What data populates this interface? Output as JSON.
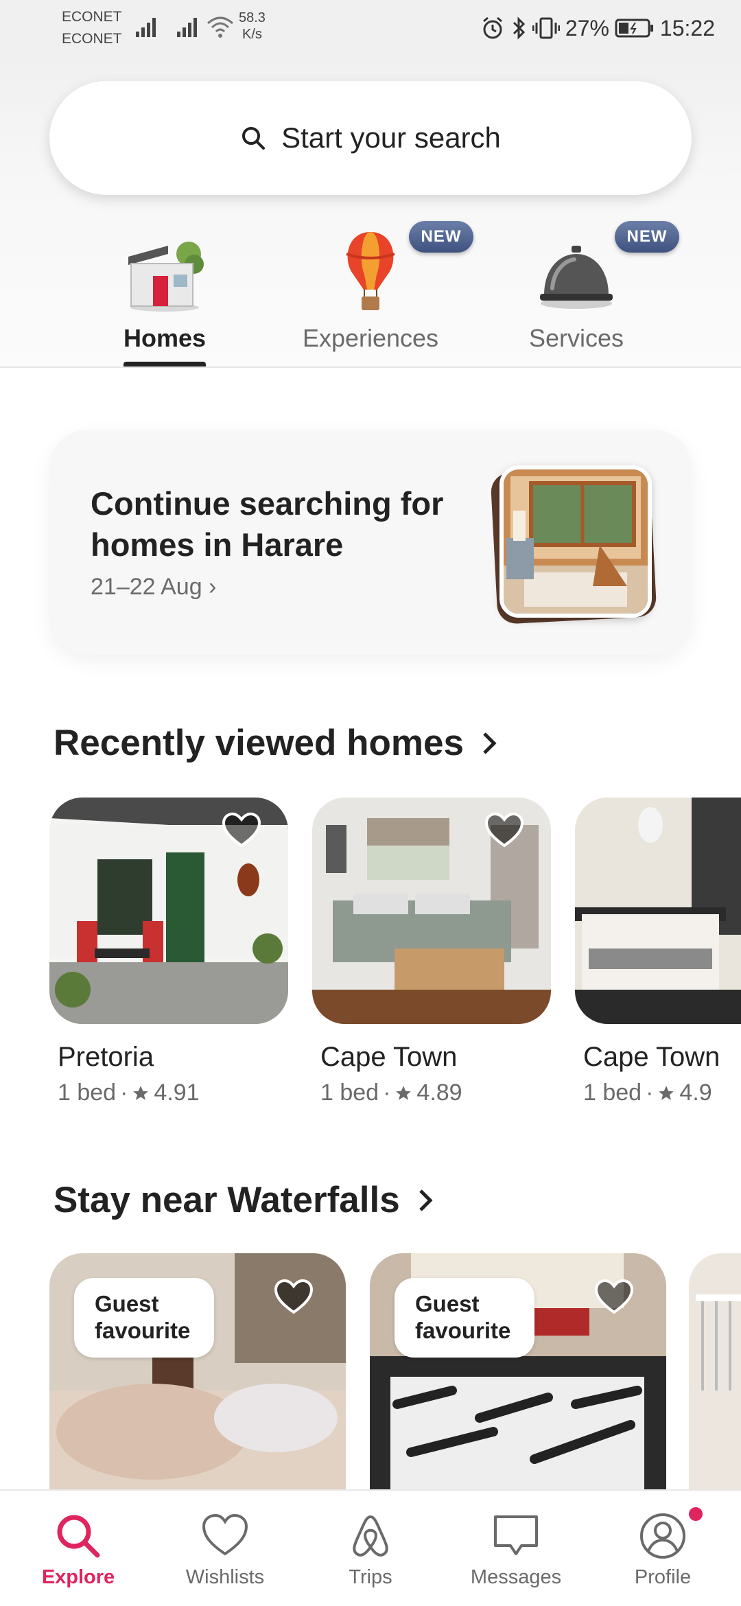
{
  "status_bar": {
    "carrier_1": "ECONET",
    "carrier_2": "ECONET",
    "net_speed_value": "58.3",
    "net_speed_unit": "K/s",
    "battery": "27%",
    "time": "15:22"
  },
  "search": {
    "label": "Start your search",
    "icon": "search-icon"
  },
  "categories": [
    {
      "label": "Homes",
      "active": true,
      "badge": ""
    },
    {
      "label": "Experiences",
      "active": false,
      "badge": "NEW"
    },
    {
      "label": "Services",
      "active": false,
      "badge": "NEW"
    }
  ],
  "continue_card": {
    "title": "Continue searching for homes in Harare",
    "dates": "21–22 Aug",
    "chevron": "›"
  },
  "recently_viewed": {
    "heading": "Recently viewed homes",
    "items": [
      {
        "city": "Pretoria",
        "beds": "1 bed",
        "rating": "4.91"
      },
      {
        "city": "Cape Town",
        "beds": "1 bed",
        "rating": "4.89"
      },
      {
        "city": "Cape Town",
        "beds": "1 bed",
        "rating": "4.9"
      }
    ]
  },
  "waterfalls": {
    "heading": "Stay near Waterfalls",
    "items": [
      {
        "badge_line1": "Guest",
        "badge_line2": "favourite"
      },
      {
        "badge_line1": "Guest",
        "badge_line2": "favourite"
      }
    ]
  },
  "bottom_nav": [
    {
      "label": "Explore",
      "icon": "search-icon",
      "active": true
    },
    {
      "label": "Wishlists",
      "icon": "heart-icon",
      "active": false
    },
    {
      "label": "Trips",
      "icon": "airbnb-logo-icon",
      "active": false
    },
    {
      "label": "Messages",
      "icon": "message-icon",
      "active": false
    },
    {
      "label": "Profile",
      "icon": "profile-icon",
      "active": false
    }
  ],
  "colors": {
    "accent": "#e0245e",
    "text": "#222222",
    "muted": "#6a6a6a",
    "badge": "#4a5d8a"
  }
}
